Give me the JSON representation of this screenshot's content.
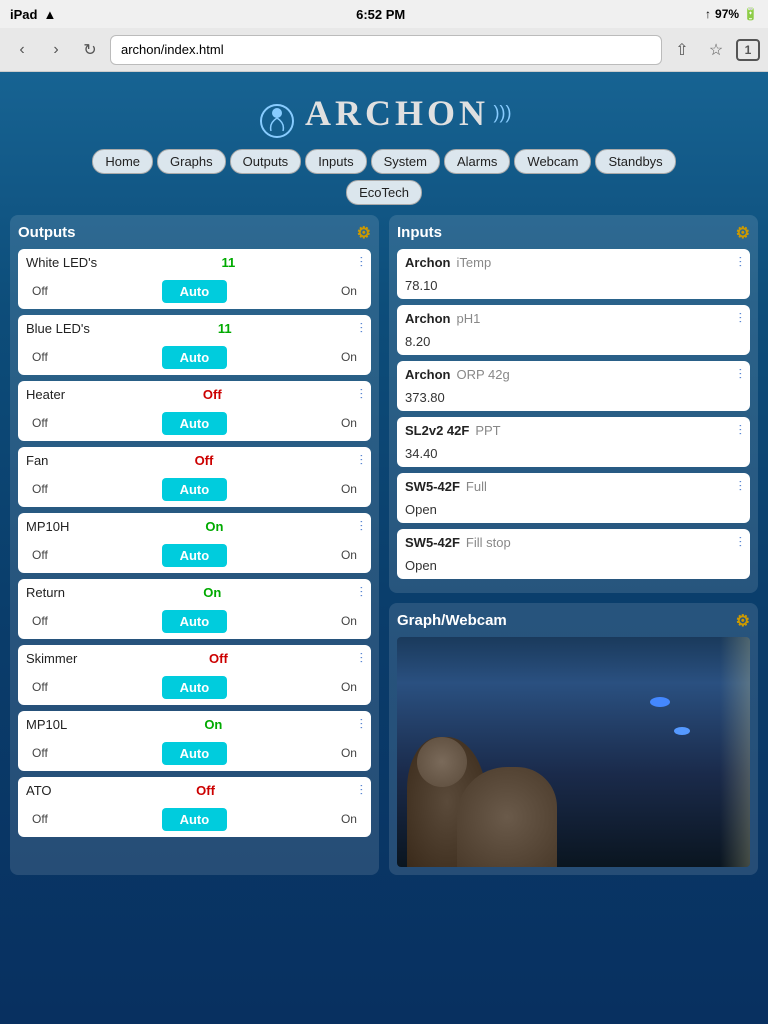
{
  "statusBar": {
    "carrier": "iPad",
    "wifi": "WiFi",
    "time": "6:52 PM",
    "battery": "97%"
  },
  "browser": {
    "url": "archon/index.html",
    "tabCount": "1"
  },
  "logo": {
    "text": "ARCHON"
  },
  "nav": {
    "items": [
      {
        "label": "Home"
      },
      {
        "label": "Graphs"
      },
      {
        "label": "Outputs"
      },
      {
        "label": "Inputs"
      },
      {
        "label": "System"
      },
      {
        "label": "Alarms"
      },
      {
        "label": "Webcam"
      },
      {
        "label": "Standbys"
      }
    ],
    "second_row": [
      {
        "label": "EcoTech"
      }
    ]
  },
  "outputs": {
    "title": "Outputs",
    "items": [
      {
        "name": "White LED's",
        "status": "11",
        "statusClass": "status-green",
        "off": "Off",
        "auto": "Auto",
        "on": "On"
      },
      {
        "name": "Blue LED's",
        "status": "11",
        "statusClass": "status-green",
        "off": "Off",
        "auto": "Auto",
        "on": "On"
      },
      {
        "name": "Heater",
        "status": "Off",
        "statusClass": "status-red",
        "off": "Off",
        "auto": "Auto",
        "on": "On"
      },
      {
        "name": "Fan",
        "status": "Off",
        "statusClass": "status-red",
        "off": "Off",
        "auto": "Auto",
        "on": "On"
      },
      {
        "name": "MP10H",
        "status": "On",
        "statusClass": "status-green",
        "off": "Off",
        "auto": "Auto",
        "on": "On"
      },
      {
        "name": "Return",
        "status": "On",
        "statusClass": "status-green",
        "off": "Off",
        "auto": "Auto",
        "on": "On"
      },
      {
        "name": "Skimmer",
        "status": "Off",
        "statusClass": "status-red",
        "off": "Off",
        "auto": "Auto",
        "on": "On"
      },
      {
        "name": "MP10L",
        "status": "On",
        "statusClass": "status-green",
        "off": "Off",
        "auto": "Auto",
        "on": "On"
      },
      {
        "name": "ATO",
        "status": "Off",
        "statusClass": "status-red",
        "off": "Off",
        "auto": "Auto",
        "on": "On"
      }
    ]
  },
  "inputs": {
    "title": "Inputs",
    "items": [
      {
        "source": "Archon",
        "label": "iTemp",
        "value": "78.10"
      },
      {
        "source": "Archon",
        "label": "pH1",
        "value": "8.20"
      },
      {
        "source": "Archon",
        "label": "ORP 42g",
        "value": "373.80"
      },
      {
        "source": "SL2v2 42F",
        "label": "PPT",
        "value": "34.40"
      },
      {
        "source": "SW5-42F",
        "label": "Full",
        "value": "Open"
      },
      {
        "source": "SW5-42F",
        "label": "Fill stop",
        "value": "Open"
      }
    ]
  },
  "graphWebcam": {
    "title": "Graph/Webcam"
  }
}
